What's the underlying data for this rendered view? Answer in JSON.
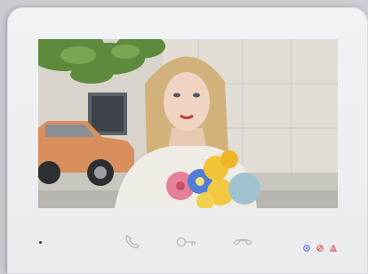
{
  "device": {
    "body_color": "#eceef1",
    "screen": {
      "content": "video-feed",
      "icon": "camera-view"
    },
    "controls": {
      "talk": {
        "icon": "phone-handset-icon"
      },
      "unlock": {
        "icon": "key-icon"
      },
      "hangup": {
        "icon": "hangup-icon"
      }
    },
    "indicators": {
      "mic_led": {
        "icon": "microphone-led-icon",
        "color": "#6a6fe0"
      },
      "mute_led": {
        "icon": "mute-led-icon",
        "color": "#e35a5a"
      },
      "alarm_led": {
        "icon": "alarm-led-icon",
        "color": "#e35a5a"
      }
    }
  }
}
